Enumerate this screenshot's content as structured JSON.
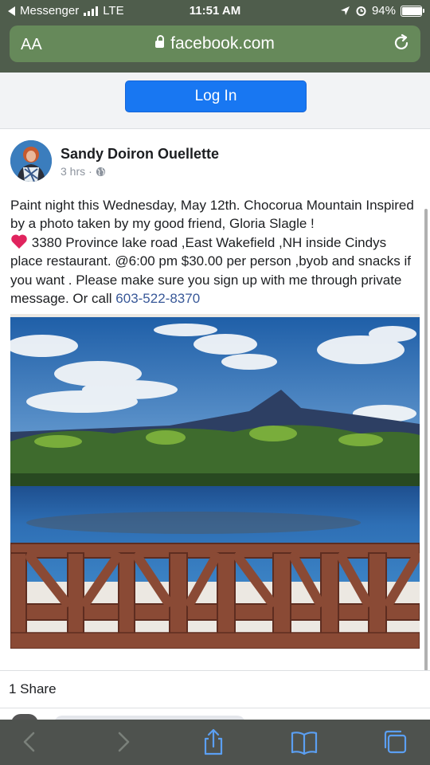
{
  "status_bar": {
    "back_app": "Messenger",
    "network": "LTE",
    "time": "11:51 AM",
    "battery": "94%",
    "battery_level": 0.94
  },
  "browser": {
    "text_size_label": "AA",
    "domain": "facebook.com"
  },
  "login": {
    "button_label": "Log In"
  },
  "post": {
    "author": "Sandy Doiron Ouellette",
    "time": "3 hrs",
    "separator": "·",
    "text_line1": "Paint night this Wednesday, May 12th. Chocorua Mountain Inspired by a photo taken by my good friend, Gloria Slagle !",
    "text_line2": "3380 Province lake road ,East Wakefield ,NH inside Cindys place restaurant. @6:00 pm $30.00 per person ,byob and snacks if you want . Please make sure you sign up with me through private message. Or call",
    "phone": "603-522-8370",
    "shares": "1 Share"
  },
  "colors": {
    "chrome": "#4f5d4c",
    "urlbar": "#66895a",
    "login_button": "#1877f2",
    "link": "#385898",
    "heart": "#e0245e"
  },
  "toolbar": {
    "icons": [
      "back-icon",
      "forward-icon",
      "share-icon",
      "bookmarks-icon",
      "tabs-icon"
    ]
  }
}
